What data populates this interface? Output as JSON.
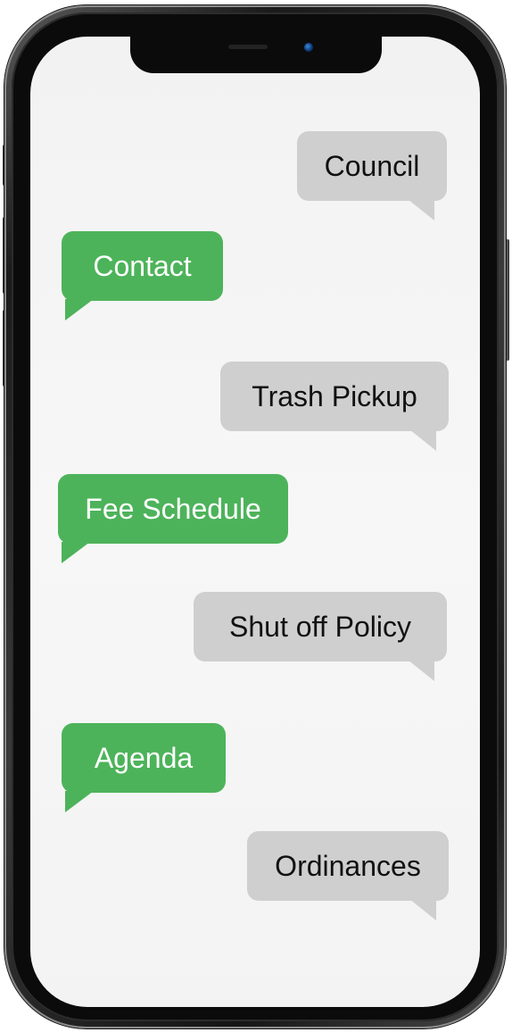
{
  "messages": [
    {
      "text": "Council",
      "style": "gray",
      "align": "right"
    },
    {
      "text": "Contact",
      "style": "green",
      "align": "left"
    },
    {
      "text": "Trash Pickup",
      "style": "gray",
      "align": "right"
    },
    {
      "text": "Fee Schedule",
      "style": "green",
      "align": "left"
    },
    {
      "text": "Shut off Policy",
      "style": "gray",
      "align": "right"
    },
    {
      "text": "Agenda",
      "style": "green",
      "align": "left"
    },
    {
      "text": "Ordinances",
      "style": "gray",
      "align": "right"
    }
  ],
  "colors": {
    "gray_bubble": "#cfcfcf",
    "green_bubble": "#4db35a",
    "screen": "#f4f4f4",
    "phone_frame": "#1b1b1b"
  }
}
